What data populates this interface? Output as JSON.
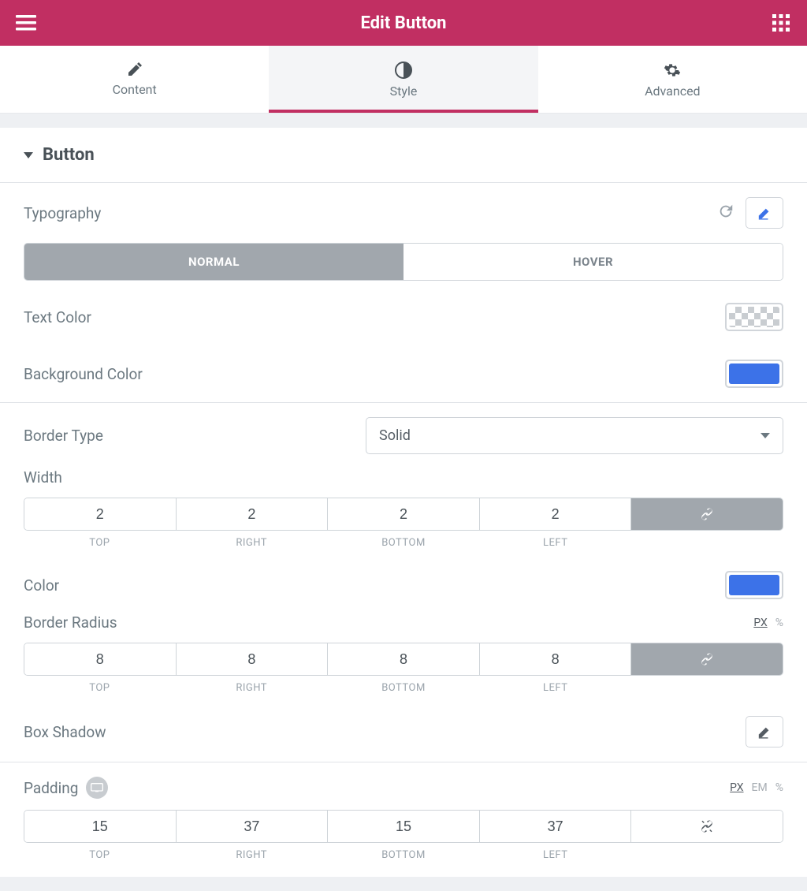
{
  "header": {
    "title": "Edit Button"
  },
  "tabs": [
    {
      "label": "Content",
      "icon": "pencil-icon"
    },
    {
      "label": "Style",
      "icon": "contrast-icon"
    },
    {
      "label": "Advanced",
      "icon": "gear-icon"
    }
  ],
  "section": {
    "title": "Button"
  },
  "typography": {
    "label": "Typography"
  },
  "state_tabs": {
    "normal": "NORMAL",
    "hover": "HOVER"
  },
  "text_color": {
    "label": "Text Color",
    "value": "transparent"
  },
  "bg_color": {
    "label": "Background Color",
    "value": "#3C72E8"
  },
  "border_type": {
    "label": "Border Type",
    "value": "Solid"
  },
  "width": {
    "label": "Width",
    "top": "2",
    "right": "2",
    "bottom": "2",
    "left": "2",
    "sublabels": {
      "top": "TOP",
      "right": "RIGHT",
      "bottom": "BOTTOM",
      "left": "LEFT"
    },
    "linked": true
  },
  "border_color": {
    "label": "Color",
    "value": "#3C72E8"
  },
  "radius": {
    "label": "Border Radius",
    "top": "8",
    "right": "8",
    "bottom": "8",
    "left": "8",
    "units": {
      "px": "PX",
      "pct": "%"
    },
    "linked": true
  },
  "box_shadow": {
    "label": "Box Shadow"
  },
  "padding": {
    "label": "Padding",
    "top": "15",
    "right": "37",
    "bottom": "15",
    "left": "37",
    "units": {
      "px": "PX",
      "em": "EM",
      "pct": "%"
    },
    "linked": false
  }
}
